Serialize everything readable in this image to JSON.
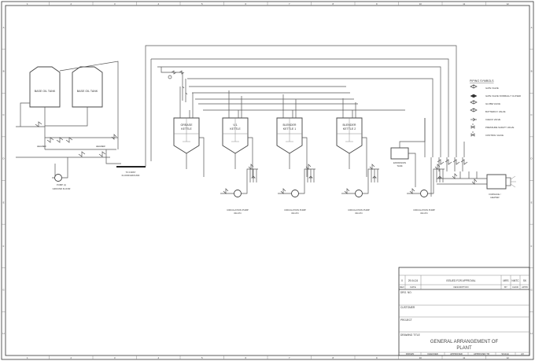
{
  "tanks": {
    "base_oil_1": "BASE OIL TANK",
    "base_oil_2": "BASE OIL TANK"
  },
  "kettles": [
    {
      "name": "GREASE",
      "sub": "KETTLE"
    },
    {
      "name": "V-1",
      "sub": "KETTLE"
    },
    {
      "name": "BLENDER",
      "sub": "KETTLE 1"
    },
    {
      "name": "BLENDER",
      "sub": "KETTLE 2"
    }
  ],
  "pumps": {
    "pump_ground": {
      "line1": "PUMP (x)",
      "line2": "GROUND FLOOR"
    },
    "circulation": [
      {
        "line1": "CIRCULATION PUMP",
        "line2": "30m³/hr"
      },
      {
        "line1": "CIRCULATION PUMP",
        "line2": "30m³/hr"
      },
      {
        "line1": "CIRCULATION PUMP",
        "line2": "30m³/hr"
      },
      {
        "line1": "CIRCULATION PUMP",
        "line2": "30m³/hr"
      }
    ]
  },
  "equipment": {
    "expansion_tank": {
      "line1": "EXPANSION",
      "line2": "TANK"
    },
    "furnace": {
      "line1": "FURNACE /",
      "line2": "HEATER"
    },
    "first_floor": {
      "line1": "TO FIRST",
      "line2": "FLOOR/GROUND"
    }
  },
  "header_labels": [
    "HEADER",
    "HEADER"
  ],
  "piping_symbols": {
    "title": "PIPING SYMBOLS",
    "items": [
      "GATE VALVE",
      "GATE VALVE NORMALLY CLOSED",
      "GLOBE VALVE",
      "BUTTERFLY VALVE",
      "CHECK VALVE",
      "PRESSURE SAFETY VALVE",
      "CONTROL VALVE"
    ]
  },
  "title_block": {
    "revision": {
      "rev": "0",
      "date": "29.04.24",
      "description": "ISSUED FOR APPROVAL",
      "by": "MRS",
      "chkd": "NMTC",
      "appd": "SK"
    },
    "rev_headers": [
      "REV",
      "DATE",
      "DESCRIPTION",
      "BY",
      "CHKD",
      "APPD"
    ],
    "fields": [
      "DRG. NO.",
      "CUSTOMER",
      "PROJECT",
      "DRAWING TITLE"
    ],
    "drawing_title_line1": "GENERAL ARRANGEMENT OF",
    "drawing_title_line2": "PLANT",
    "footer": [
      "DRAWN",
      "CHECKED",
      "APPROVED",
      "APPROVED TR",
      "SCALE",
      "A3"
    ]
  },
  "border": {
    "cols": [
      "1",
      "2",
      "3",
      "4",
      "5",
      "6",
      "7",
      "8",
      "9",
      "10",
      "11",
      "12"
    ],
    "rows": [
      "A",
      "B",
      "C",
      "D",
      "E",
      "F",
      "G",
      "H"
    ]
  }
}
